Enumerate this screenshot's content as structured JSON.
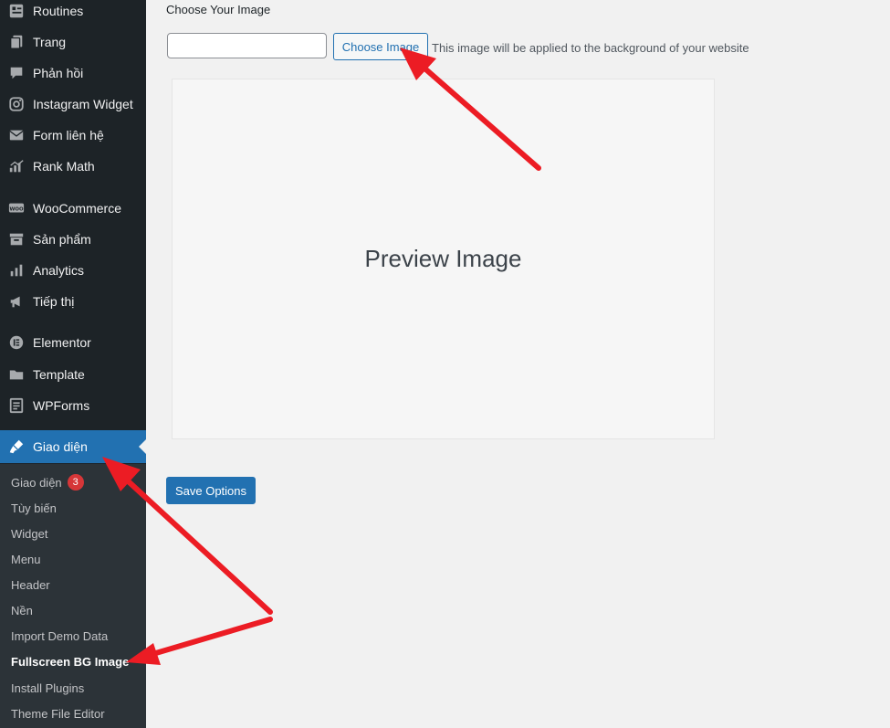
{
  "sidebar": {
    "items": [
      {
        "label": "Routines",
        "icon": "routines-icon"
      },
      {
        "label": "Trang",
        "icon": "pages-icon"
      },
      {
        "label": "Phản hồi",
        "icon": "comments-icon"
      },
      {
        "label": "Instagram Widget",
        "icon": "instagram-icon"
      },
      {
        "label": "Form liên hệ",
        "icon": "mail-icon"
      },
      {
        "label": "Rank Math",
        "icon": "rank-math-icon"
      },
      {
        "label": "WooCommerce",
        "icon": "woocommerce-icon"
      },
      {
        "label": "Sản phẩm",
        "icon": "archive-icon"
      },
      {
        "label": "Analytics",
        "icon": "analytics-icon"
      },
      {
        "label": "Tiếp thị",
        "icon": "megaphone-icon"
      },
      {
        "label": "Elementor",
        "icon": "elementor-icon"
      },
      {
        "label": "Template",
        "icon": "folder-icon"
      },
      {
        "label": "WPForms",
        "icon": "forms-icon"
      },
      {
        "label": "Giao diện",
        "icon": "brush-icon"
      }
    ],
    "submenu": [
      {
        "label": "Giao diện",
        "badge": "3"
      },
      {
        "label": "Tùy biến"
      },
      {
        "label": "Widget"
      },
      {
        "label": "Menu"
      },
      {
        "label": "Header"
      },
      {
        "label": "Nền"
      },
      {
        "label": "Import Demo Data"
      },
      {
        "label": "Fullscreen BG Image"
      },
      {
        "label": "Install Plugins"
      },
      {
        "label": "Theme File Editor"
      }
    ]
  },
  "main": {
    "section_label": "Choose Your Image",
    "image_input": {
      "value": "",
      "placeholder": ""
    },
    "choose_button": "Choose Image",
    "help_text": "This image will be applied to the background of your website",
    "preview_text": "Preview Image",
    "save_button": "Save Options"
  },
  "colors": {
    "sidebar_bg": "#1d2327",
    "submenu_bg": "#2c3338",
    "accent": "#2271b1",
    "badge": "#d63638",
    "annotation_arrow": "#ec1c24"
  }
}
